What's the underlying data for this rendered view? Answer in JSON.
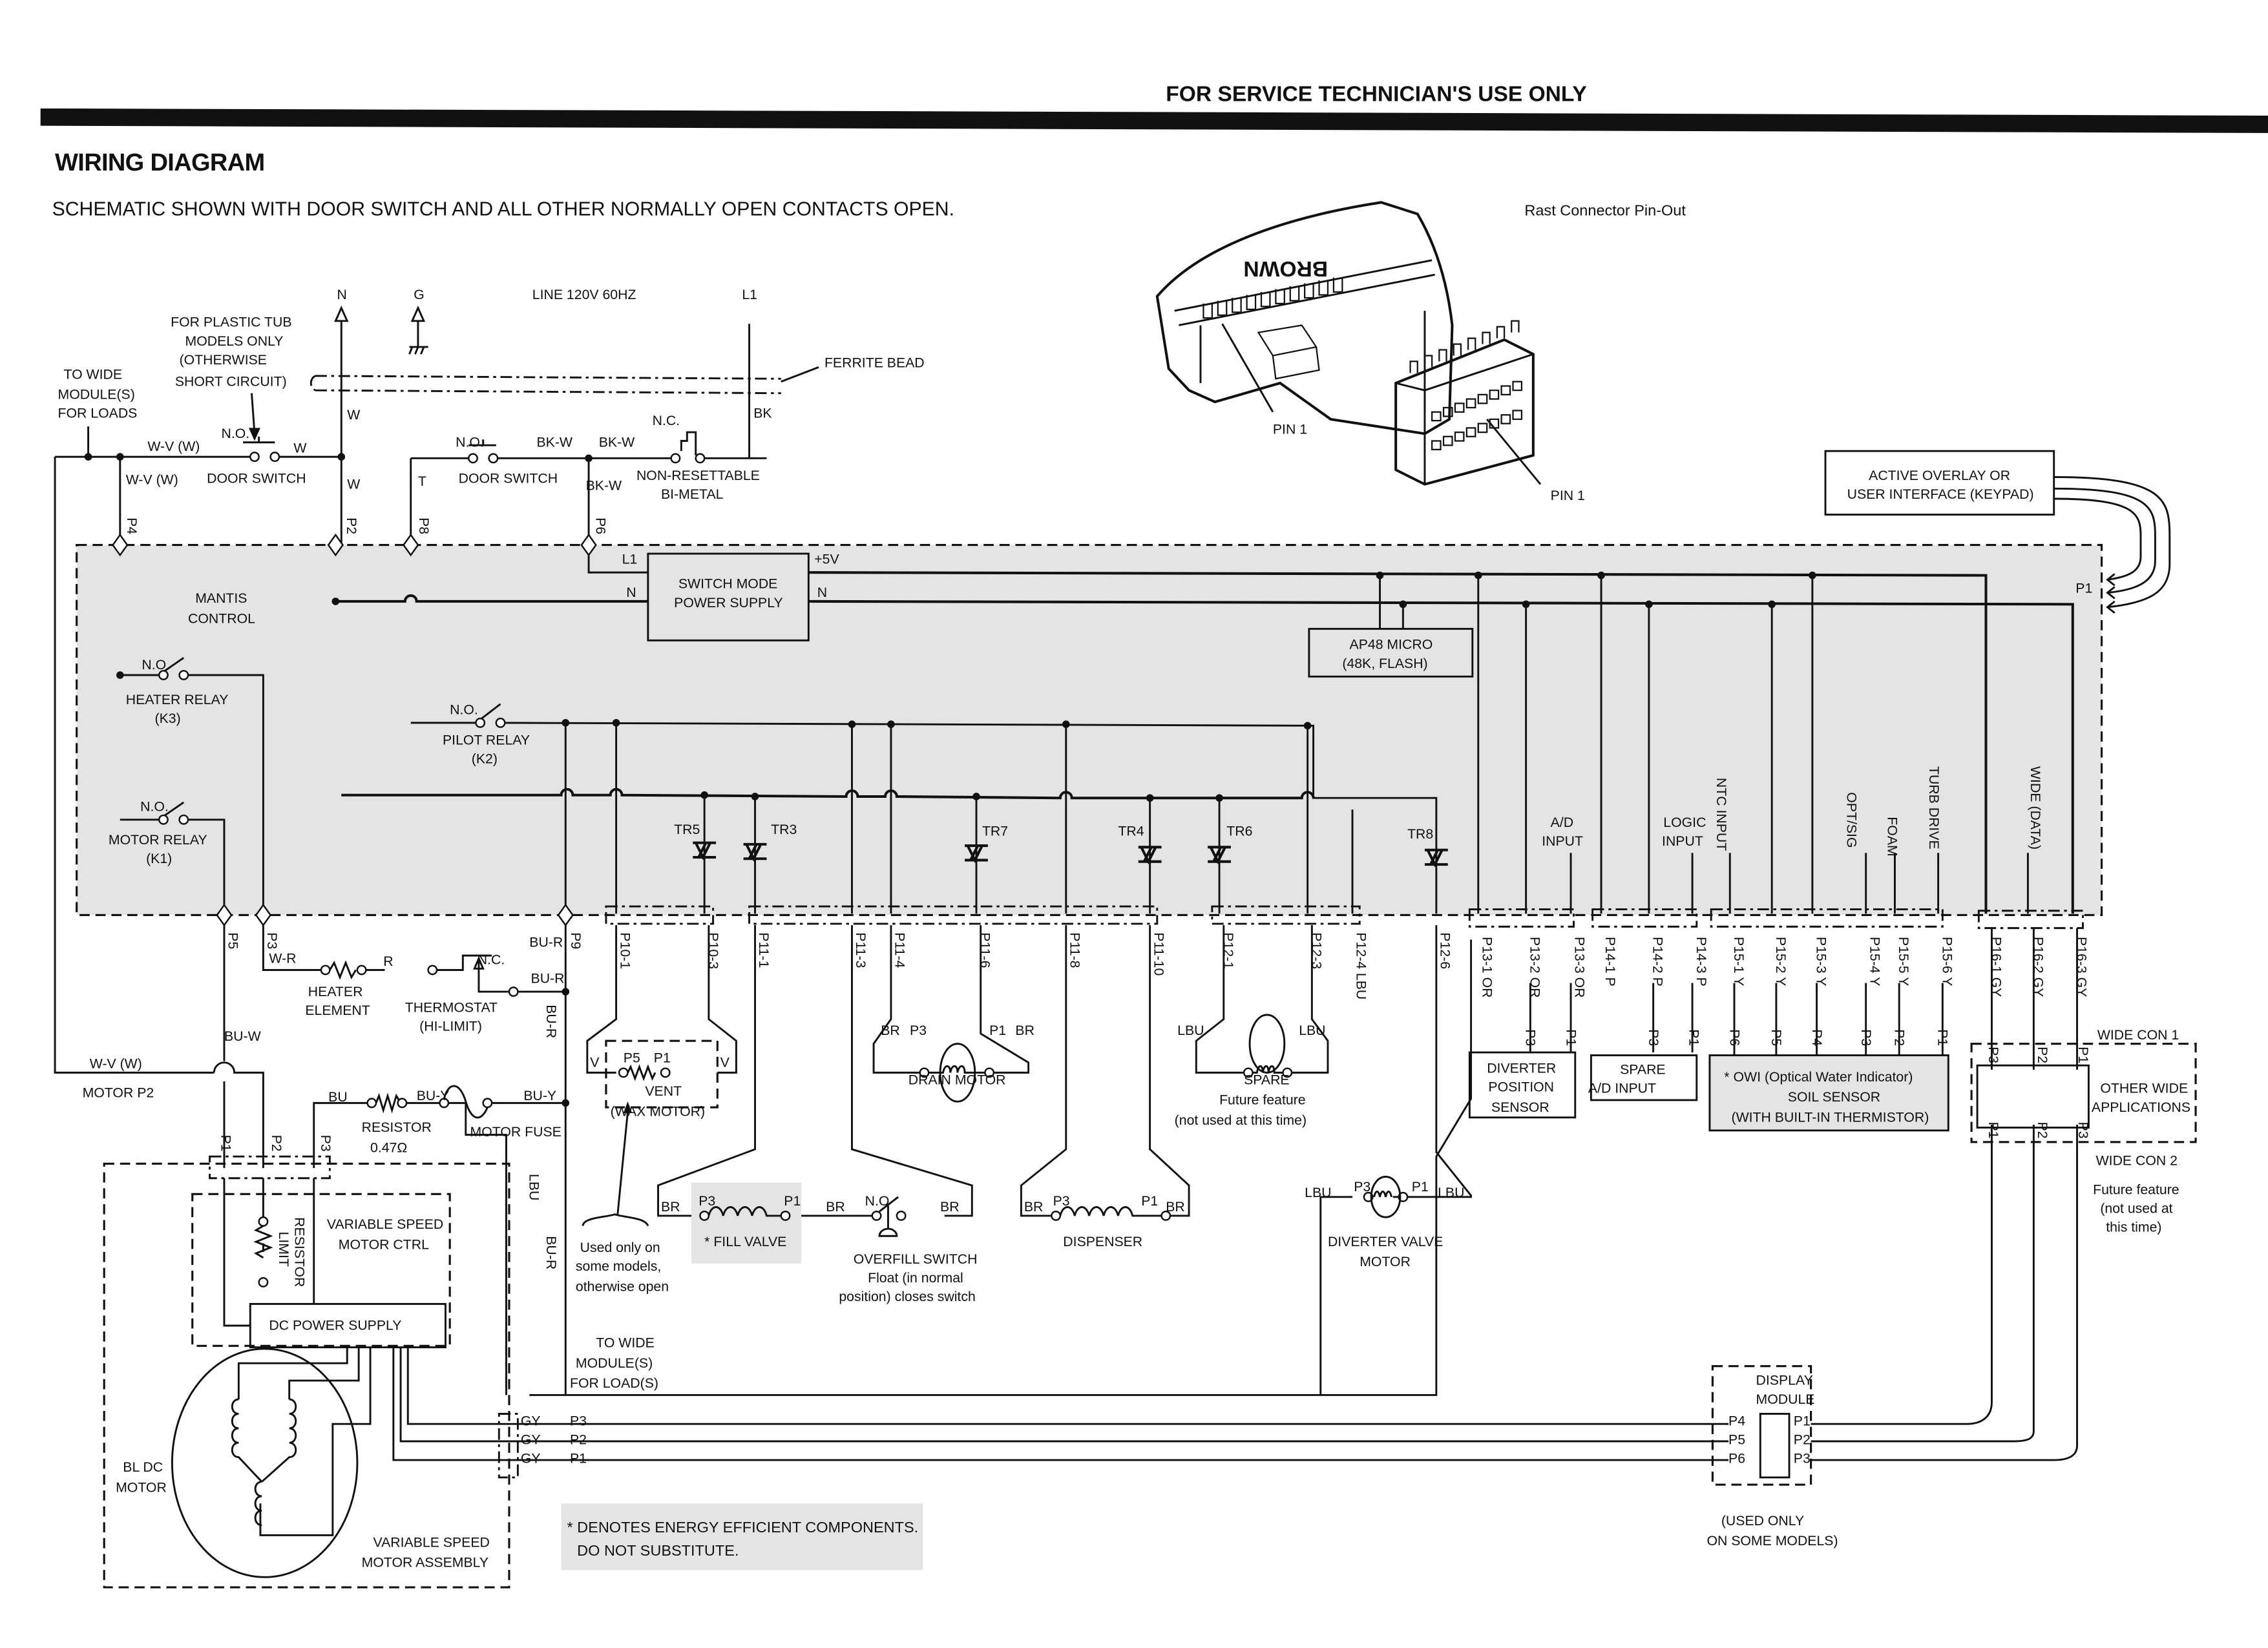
{
  "header": {
    "service_note": "FOR SERVICE TECHNICIAN'S USE ONLY",
    "title": "WIRING DIAGRAM",
    "subtitle": "SCHEMATIC SHOWN WITH DOOR SWITCH AND ALL OTHER NORMALLY OPEN CONTACTS OPEN."
  },
  "rast": {
    "title": "Rast Connector Pin-Out",
    "brand": "BROWN",
    "pin1_a": "PIN 1",
    "pin1_b": "PIN 1"
  },
  "supply": {
    "n": "N",
    "g": "G",
    "line": "LINE 120V 60HZ",
    "l1": "L1",
    "ferrite": "FERRITE BEAD",
    "plastic_tub": [
      "FOR PLASTIC TUB",
      "MODELS ONLY",
      "(OTHERWISE",
      "SHORT CIRCUIT)"
    ],
    "to_wide": [
      "TO WIDE",
      "MODULE(S)",
      "FOR LOADS"
    ],
    "wv_top": "W-V (W)",
    "wv_side": "W-V (W)",
    "no1": "N.O.",
    "w1": "W",
    "door_switch1": "DOOR SWITCH",
    "w_vert1": "W",
    "w_vert2": "W",
    "t": "T",
    "no2": "N.O.",
    "bkw1": "BK-W",
    "bkw2": "BK-W",
    "bkw3": "BK-W",
    "door_switch2": "DOOR SWITCH",
    "nc": "N.C.",
    "bimetal": [
      "NON-RESETTABLE",
      "BI-METAL"
    ],
    "bk": "BK"
  },
  "keypad": {
    "label": [
      "ACTIVE OVERLAY OR",
      "USER INTERFACE (KEYPAD)"
    ],
    "p1": "P1"
  },
  "control": {
    "name": [
      "MANTIS",
      "CONTROL"
    ],
    "pins_top": [
      "P4",
      "P2",
      "P8",
      "P6"
    ],
    "smps": [
      "SWITCH MODE",
      "POWER SUPPLY"
    ],
    "smps_l1": "L1",
    "smps_n_in": "N",
    "smps_5v": "+5V",
    "smps_n_out": "N",
    "micro": [
      "AP48 MICRO",
      "(48K, FLASH)"
    ],
    "heater_relay": {
      "no": "N.O.",
      "name": "HEATER RELAY",
      "id": "(K3)"
    },
    "motor_relay": {
      "no": "N.O.",
      "name": "MOTOR RELAY",
      "id": "(K1)"
    },
    "pilot_relay": {
      "no": "N.O.",
      "name": "PILOT RELAY",
      "id": "(K2)"
    },
    "triacs": [
      "TR5",
      "TR3",
      "TR7",
      "TR4",
      "TR6",
      "TR8"
    ],
    "inputs": {
      "ad": [
        "A/D",
        "INPUT"
      ],
      "logic": [
        "LOGIC",
        "INPUT"
      ],
      "ntc": "NTC INPUT",
      "opt": "OPT/SIG",
      "foam": "FOAM",
      "turb": "TURB DRIVE",
      "wide": "WIDE (DATA)"
    }
  },
  "connectors": {
    "lower_left": [
      "P5",
      "P3",
      "P9"
    ],
    "p10": [
      "P10-1",
      "P10-3"
    ],
    "p11": [
      "P11-1",
      "P11-3",
      "P11-4",
      "P11-6",
      "P11-8",
      "P11-10"
    ],
    "p12": [
      "P12-1",
      "P12-3",
      "P12-4 LBU",
      "P12-6"
    ],
    "p13": [
      "P13-1 OR",
      "P13-2 OR",
      "P13-3 OR"
    ],
    "p14": [
      "P14-1 P",
      "P14-2 P",
      "P14-3 P"
    ],
    "p15": [
      "P15-1 Y",
      "P15-2 Y",
      "P15-3 Y",
      "P15-4 Y",
      "P15-5 Y",
      "P15-6 Y"
    ],
    "p16": [
      "P16-1 GY",
      "P16-2 GY",
      "P16-3 GY"
    ]
  },
  "heater_circuit": {
    "wr": "W-R",
    "r": "R",
    "nc": "N.C.",
    "bur1": "BU-R",
    "bur2": "BU-R",
    "bur3": "BU-R",
    "heater": [
      "HEATER",
      "ELEMENT"
    ],
    "thermostat": [
      "THERMOSTAT",
      "(HI-LIMIT)"
    ],
    "buw": "BU-W",
    "wv": "W-V (W)",
    "motor_p2": "MOTOR P2"
  },
  "motor_circuit": {
    "bu": "BU",
    "buy1": "BU-Y",
    "buy2": "BU-Y",
    "resistor": [
      "RESISTOR",
      "0.47Ω"
    ],
    "fuse": "MOTOR FUSE",
    "lbu": "LBU",
    "bur": "BU-R",
    "pins": [
      "P1",
      "P2",
      "P3"
    ],
    "limit_resistor": [
      "LIMIT",
      "RESISTOR"
    ],
    "vs_ctrl": [
      "VARIABLE SPEED",
      "MOTOR CTRL"
    ],
    "dc_supply": "DC POWER SUPPLY",
    "bldc": [
      "BL DC",
      "MOTOR"
    ],
    "assembly": [
      "VARIABLE SPEED",
      "MOTOR ASSEMBLY"
    ],
    "gy_lines": [
      {
        "color": "GY",
        "pin": "P3"
      },
      {
        "color": "GY",
        "pin": "P2"
      },
      {
        "color": "GY",
        "pin": "P1"
      }
    ],
    "to_wide": [
      "TO WIDE",
      "MODULE(S)",
      "FOR LOAD(S)"
    ]
  },
  "loads": {
    "vent": {
      "v1": "V",
      "p5": "P5",
      "p1": "P1",
      "v2": "V",
      "name": [
        "VENT",
        "(WAX MOTOR)"
      ]
    },
    "vent_note": [
      "Used only on",
      "some models,",
      "otherwise open"
    ],
    "drain": {
      "br1": "BR",
      "p3": "P3",
      "p1": "P1",
      "br2": "BR",
      "name": "DRAIN MOTOR"
    },
    "spare": {
      "lbu1": "LBU",
      "lbu2": "LBU",
      "name": "SPARE",
      "note": [
        "Future feature",
        "(not used at this time)"
      ]
    },
    "fill": {
      "br1": "BR",
      "p3": "P3",
      "p1": "P1",
      "br2": "BR",
      "name": "* FILL VALVE"
    },
    "overfill": {
      "no": "N.O",
      "br": "BR",
      "name": "OVERFILL SWITCH",
      "note": [
        "Float (in normal",
        "position) closes switch"
      ]
    },
    "dispenser": {
      "br1": "BR",
      "p3": "P3",
      "p1": "P1",
      "br2": "BR",
      "name": "DISPENSER"
    },
    "diverter_motor": {
      "lbu1": "LBU",
      "p3": "P3",
      "p1": "P1",
      "lbu2": "LBU",
      "name": [
        "DIVERTER VALVE",
        "MOTOR"
      ]
    }
  },
  "sensors": {
    "diverter": {
      "pins": [
        "P3",
        "P1"
      ],
      "name": [
        "DIVERTER",
        "POSITION",
        "SENSOR"
      ]
    },
    "spare_ad": {
      "pins": [
        "P3",
        "P1"
      ],
      "name": [
        "SPARE",
        "A/D INPUT"
      ]
    },
    "owi": {
      "pins": [
        "P6",
        "P5",
        "P4",
        "P3",
        "P2",
        "P1"
      ],
      "name": [
        "* OWI (Optical Water Indicator)",
        "SOIL SENSOR",
        "(WITH BUILT-IN THERMISTOR)"
      ]
    }
  },
  "wide": {
    "con1": "WIDE CON 1",
    "con2": "WIDE CON 2",
    "top_pins": [
      "P3",
      "P2",
      "P1"
    ],
    "bottom_pins": [
      "P1",
      "P2",
      "P3"
    ],
    "name": [
      "OTHER WIDE",
      "APPLICATIONS"
    ],
    "note": [
      "Future feature",
      "(not used at",
      "this time)"
    ]
  },
  "display": {
    "name": [
      "DISPLAY",
      "MODULE"
    ],
    "left_pins": [
      "P4",
      "P5",
      "P6"
    ],
    "right_pins": [
      "P1",
      "P2",
      "P3"
    ],
    "note": [
      "(USED ONLY",
      "ON SOME MODELS)"
    ]
  },
  "footnote": [
    "* DENOTES ENERGY EFFICIENT COMPONENTS.",
    "DO NOT SUBSTITUTE."
  ]
}
